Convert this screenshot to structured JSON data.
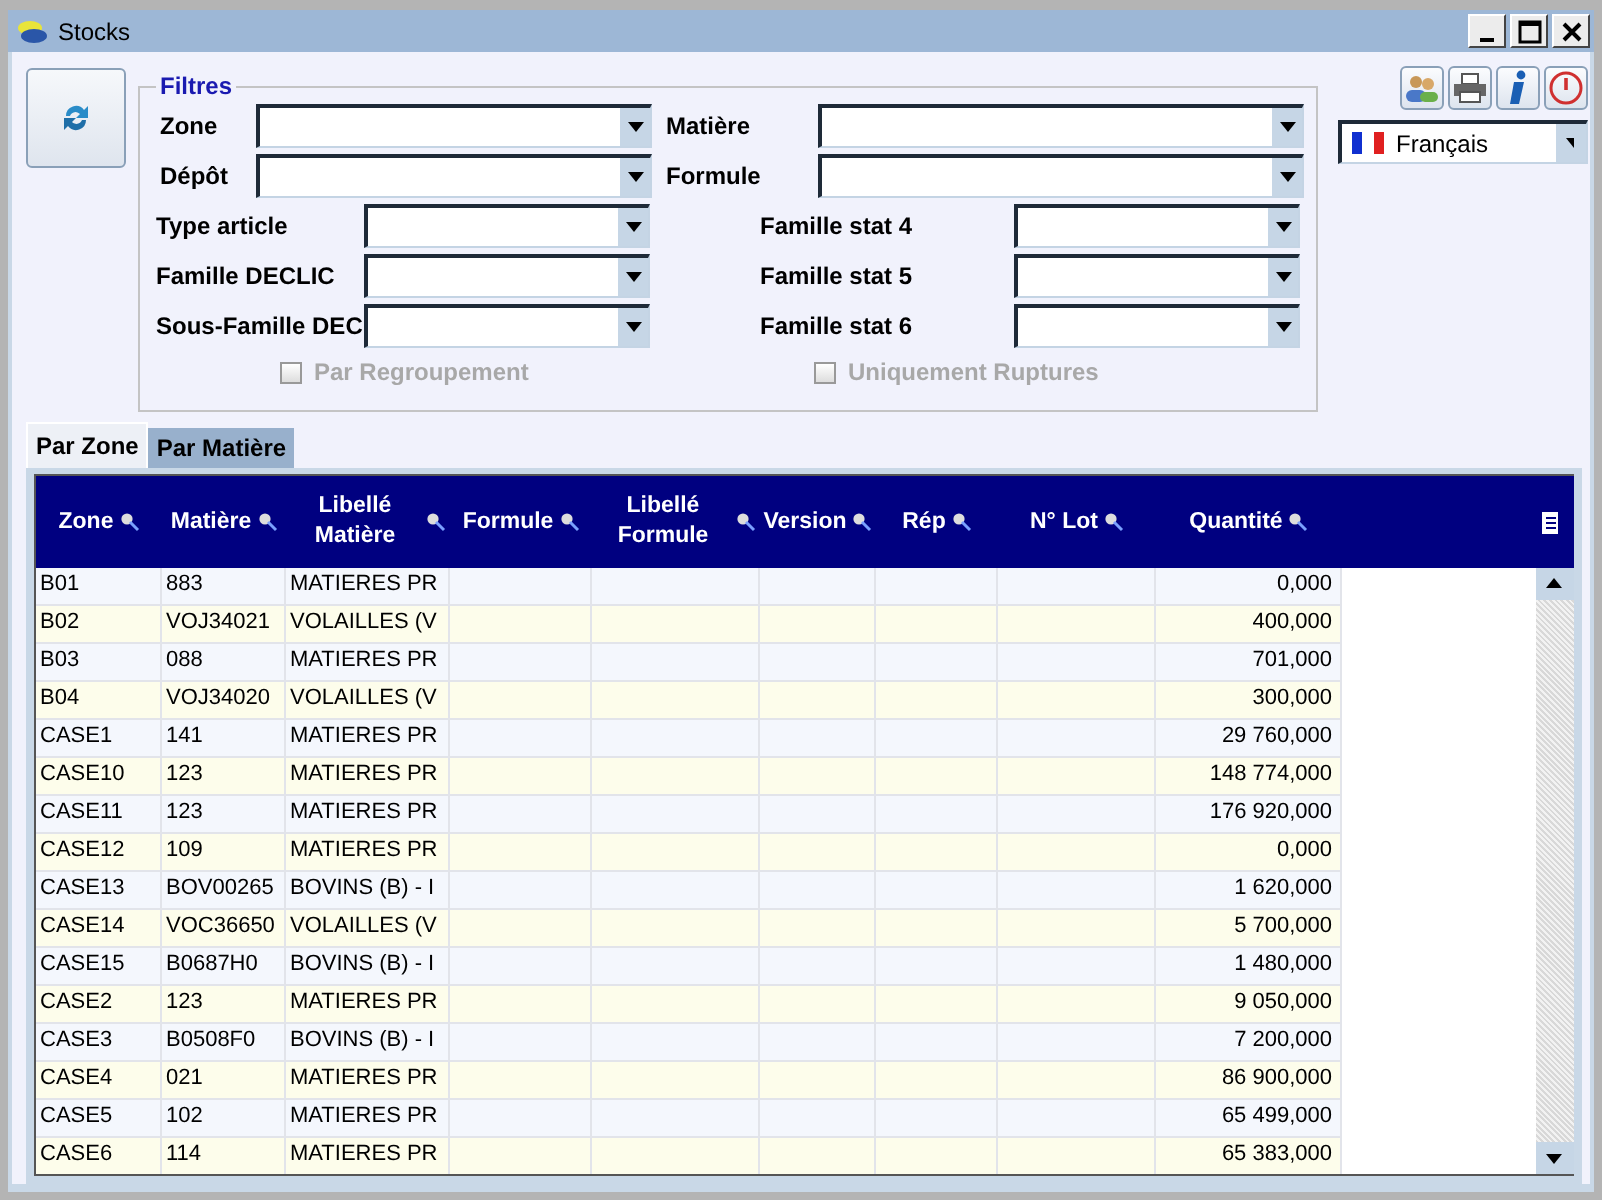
{
  "window": {
    "title": "Stocks"
  },
  "filters": {
    "title": "Filtres",
    "top_fields": [
      {
        "label": "Zone"
      },
      {
        "label": "Matière"
      },
      {
        "label": "Dépôt"
      },
      {
        "label": "Formule"
      }
    ],
    "stat_fields": [
      {
        "label": "Type article"
      },
      {
        "label": "Famille stat 4"
      },
      {
        "label": "Famille DECLIC"
      },
      {
        "label": "Famille stat 5"
      },
      {
        "label": "Sous-Famille DEC"
      },
      {
        "label": "Famille stat 6"
      }
    ],
    "checkboxes": [
      {
        "label": "Par Regroupement",
        "checked": false,
        "disabled": true
      },
      {
        "label": "Uniquement Ruptures",
        "checked": false,
        "disabled": true
      }
    ]
  },
  "language": {
    "value": "Français"
  },
  "tabs": [
    {
      "label": "Par Zone",
      "selected": true
    },
    {
      "label": "Par Matière",
      "selected": false
    }
  ],
  "table": {
    "columns": [
      {
        "label": "Zone"
      },
      {
        "label": "Matière"
      },
      {
        "label": "Libellé Matière"
      },
      {
        "label": "Formule"
      },
      {
        "label": "Libellé Formule"
      },
      {
        "label": "Version"
      },
      {
        "label": "Rép"
      },
      {
        "label": "N° Lot"
      },
      {
        "label": "Quantité"
      }
    ],
    "rows": [
      {
        "zone": "B01",
        "matiere": "883",
        "libelle": "MATIERES PR",
        "quantite": "0,000"
      },
      {
        "zone": "B02",
        "matiere": "VOJ34021",
        "libelle": "VOLAILLES (V",
        "quantite": "400,000"
      },
      {
        "zone": "B03",
        "matiere": "088",
        "libelle": "MATIERES PR",
        "quantite": "701,000"
      },
      {
        "zone": "B04",
        "matiere": "VOJ34020",
        "libelle": "VOLAILLES (V",
        "quantite": "300,000"
      },
      {
        "zone": "CASE1",
        "matiere": "141",
        "libelle": "MATIERES PR",
        "quantite": "29 760,000"
      },
      {
        "zone": "CASE10",
        "matiere": "123",
        "libelle": "MATIERES PR",
        "quantite": "148 774,000"
      },
      {
        "zone": "CASE11",
        "matiere": "123",
        "libelle": "MATIERES PR",
        "quantite": "176 920,000"
      },
      {
        "zone": "CASE12",
        "matiere": "109",
        "libelle": "MATIERES PR",
        "quantite": "0,000"
      },
      {
        "zone": "CASE13",
        "matiere": "BOV00265",
        "libelle": "BOVINS (B) - I",
        "quantite": "1 620,000"
      },
      {
        "zone": "CASE14",
        "matiere": "VOC36650",
        "libelle": "VOLAILLES (V",
        "quantite": "5 700,000"
      },
      {
        "zone": "CASE15",
        "matiere": "B0687H0",
        "libelle": "BOVINS (B) - I",
        "quantite": "1 480,000"
      },
      {
        "zone": "CASE2",
        "matiere": "123",
        "libelle": "MATIERES PR",
        "quantite": "9 050,000"
      },
      {
        "zone": "CASE3",
        "matiere": "B0508F0",
        "libelle": "BOVINS (B) - I",
        "quantite": "7 200,000"
      },
      {
        "zone": "CASE4",
        "matiere": "021",
        "libelle": "MATIERES PR",
        "quantite": "86 900,000"
      },
      {
        "zone": "CASE5",
        "matiere": "102",
        "libelle": "MATIERES PR",
        "quantite": "65 499,000"
      },
      {
        "zone": "CASE6",
        "matiere": "114",
        "libelle": "MATIERES PR",
        "quantite": "65 383,000"
      }
    ]
  }
}
